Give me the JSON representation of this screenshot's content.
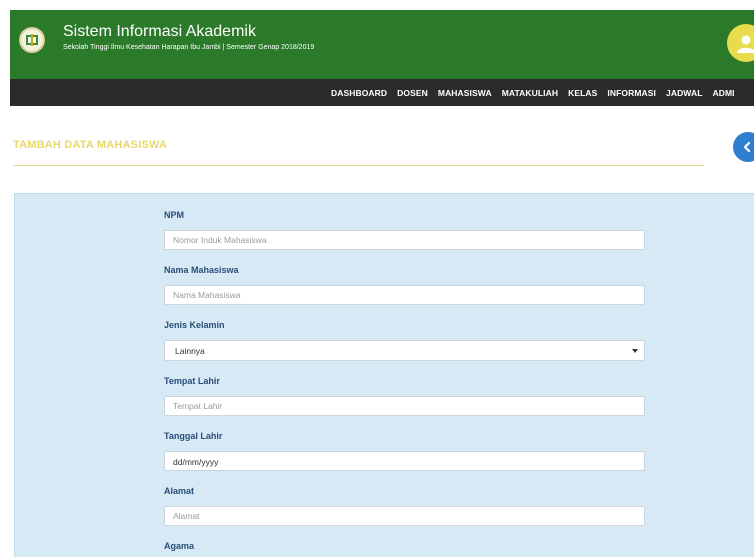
{
  "header": {
    "title": "Sistem Informasi Akademik",
    "subtitle": "Sekolah Tinggi Ilmu Kesehatan Harapan Ibu Jambi | Semester Genap 2018/2019"
  },
  "nav": {
    "items": [
      "DASHBOARD",
      "DOSEN",
      "MAHASISWA",
      "MATAKULIAH",
      "KELAS",
      "INFORMASI",
      "JADWAL",
      "ADMI"
    ]
  },
  "page": {
    "heading": "TAMBAH DATA MAHASISWA"
  },
  "form": {
    "npm": {
      "label": "NPM",
      "placeholder": "Nomor Induk Mahasiswa"
    },
    "nama": {
      "label": "Nama Mahasiswa",
      "placeholder": "Nama Mahasiswa"
    },
    "jenis_kelamin": {
      "label": "Jenis Kelamin",
      "value": "Lainnya"
    },
    "tempat_lahir": {
      "label": "Tempat Lahir",
      "placeholder": "Tempat Lahir"
    },
    "tanggal_lahir": {
      "label": "Tanggal Lahir",
      "value": "dd/mm/yyyy"
    },
    "alamat": {
      "label": "Alamat",
      "placeholder": "Alamat"
    },
    "agama": {
      "label": "Agama"
    }
  },
  "colors": {
    "header_green": "#2b7a2a",
    "nav_dark": "#2b2b2b",
    "heading_yellow": "#e8d86a",
    "panel_blue": "#d6e9f4",
    "label_blue": "#2a4e7a",
    "back_button_blue": "#2f7fd0",
    "avatar_yellow": "#e8dc4d"
  },
  "icons": {
    "logo": "campus-logo-icon",
    "avatar": "user-icon",
    "back": "chevron-left-icon",
    "select": "caret-down-icon"
  }
}
